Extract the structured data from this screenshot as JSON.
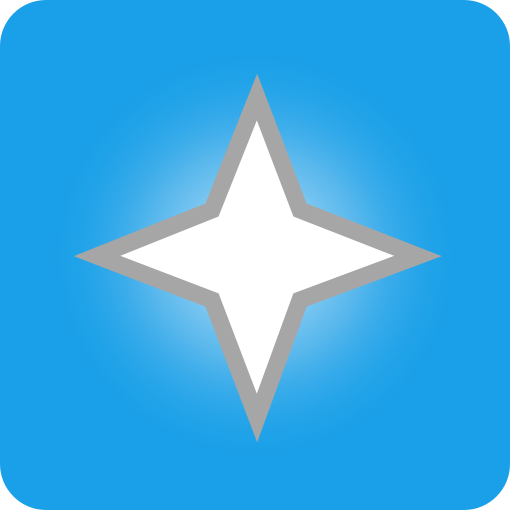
{
  "icon": {
    "name": "four-point-star-icon",
    "colors": {
      "background": "#1aa0e8",
      "glow": "#e8f6ff",
      "star_fill": "#ffffff",
      "star_stroke": "#a6a6a6"
    }
  }
}
